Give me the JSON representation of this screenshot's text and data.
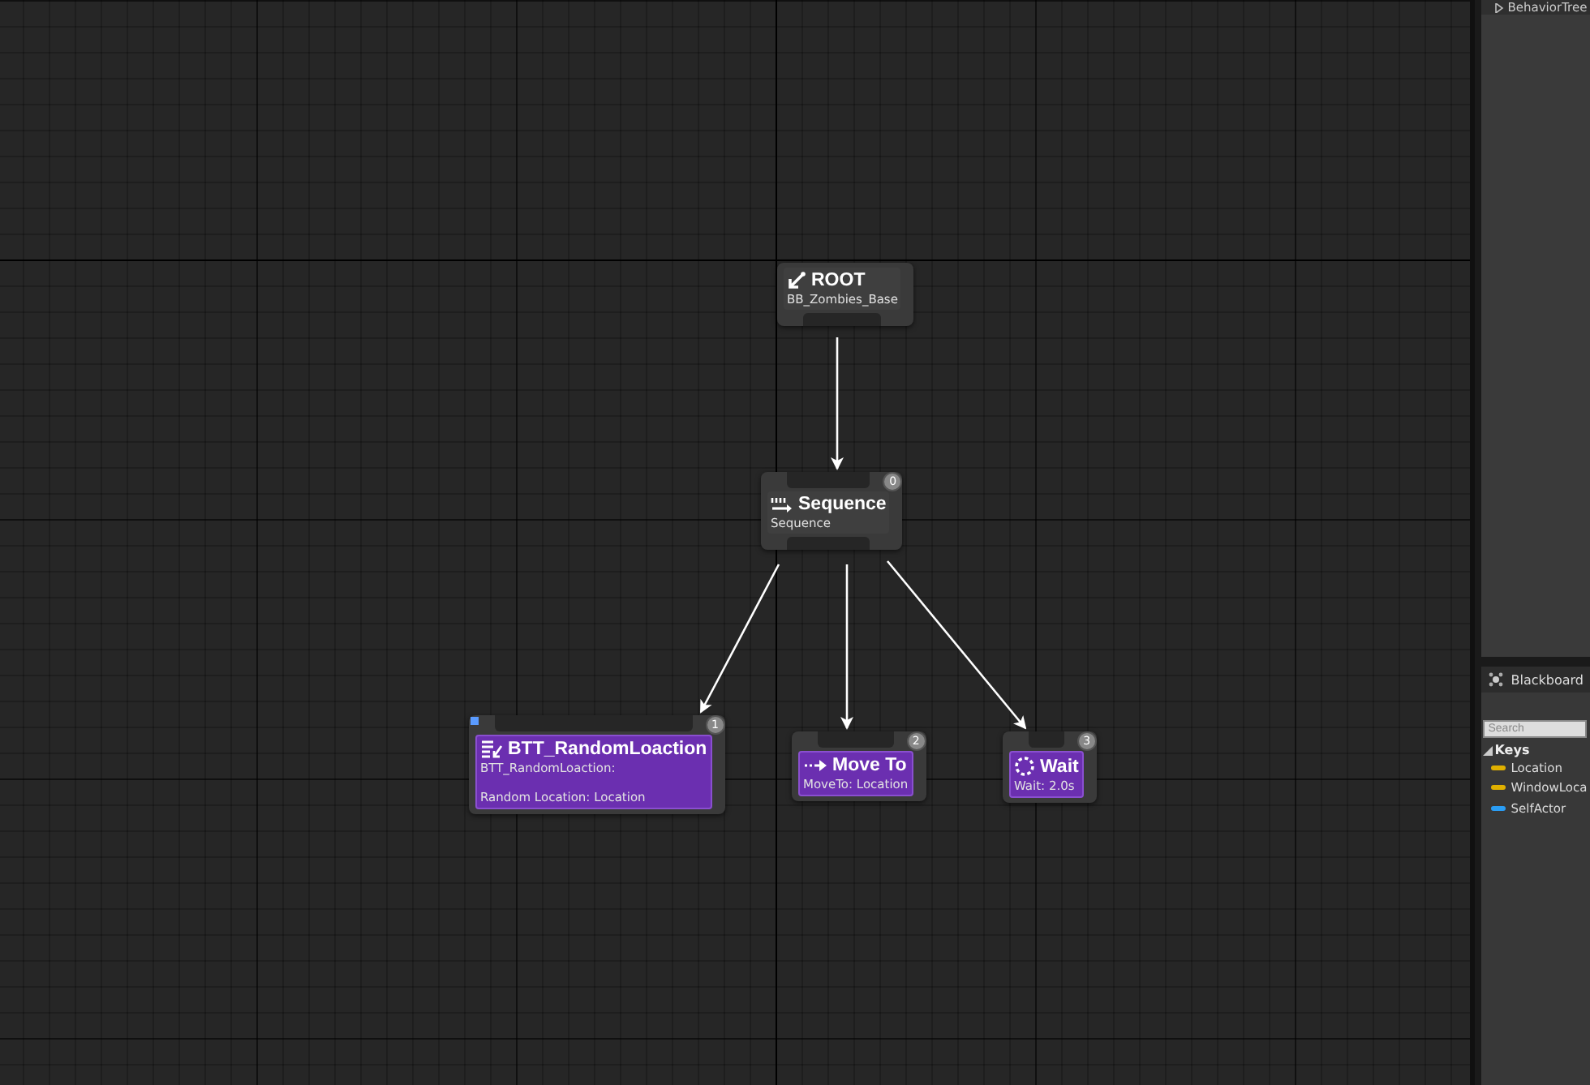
{
  "graph": {
    "root": {
      "title": "ROOT",
      "subtitle": "BB_Zombies_Base",
      "children": [
        {
          "kind": "sequence",
          "title": "Sequence",
          "index": "0",
          "lines": [
            "Sequence"
          ],
          "children": [
            {
              "kind": "blueprint_task",
              "title": "BTT_RandomLoaction",
              "index": "1",
              "lines": [
                "BTT_RandomLoaction:",
                "Random Location: Location"
              ]
            },
            {
              "kind": "move_to",
              "title": "Move To",
              "index": "2",
              "lines": [
                "MoveTo: Location"
              ]
            },
            {
              "kind": "wait",
              "title": "Wait",
              "index": "3",
              "lines": [
                "Wait: 2.0s"
              ]
            }
          ]
        }
      ]
    }
  },
  "details_panel": {
    "title": "BehaviorTree"
  },
  "blackboard": {
    "tab": "Blackboard",
    "search": {
      "placeholder": "Search"
    },
    "keys_header": "Keys",
    "keys": [
      {
        "name": "Location",
        "color": "#e0b000"
      },
      {
        "name": "WindowLoca",
        "color": "#e0b000"
      },
      {
        "name": "SelfActor",
        "color": "#2a9df4"
      }
    ]
  }
}
